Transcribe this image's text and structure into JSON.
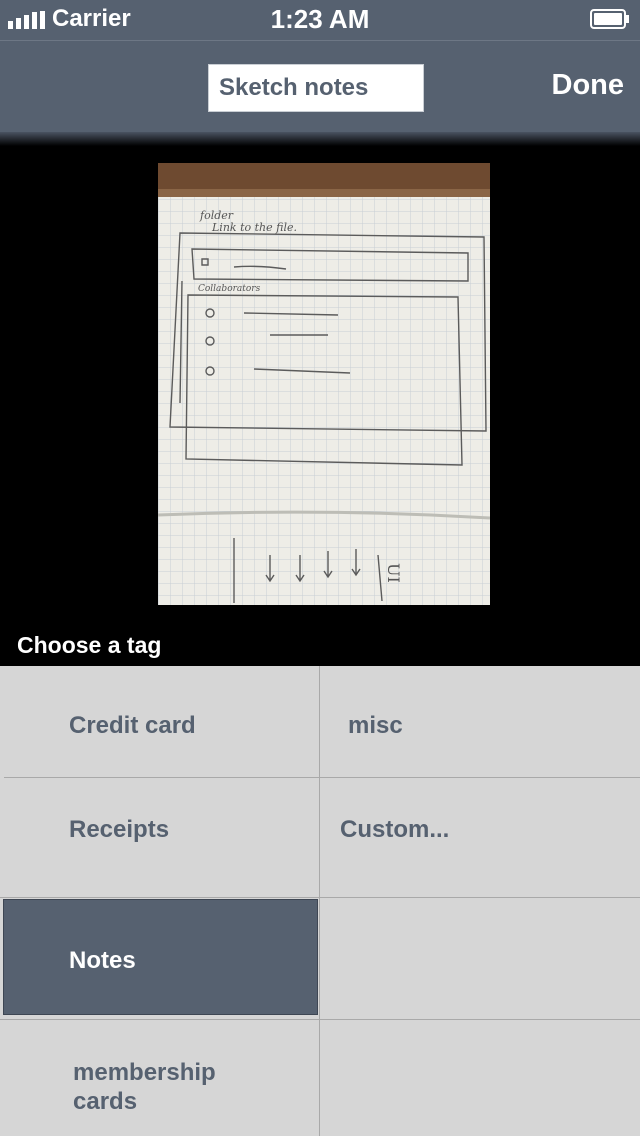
{
  "status_bar": {
    "carrier": "Carrier",
    "time": "1:23 AM"
  },
  "nav": {
    "title_value": "Sketch notes",
    "done_label": "Done"
  },
  "photo": {
    "handwriting_top": "folder",
    "handwriting_line": "Link to the file.",
    "handwriting_section": "Collaborators",
    "handwriting_bottom_ui": "UI"
  },
  "tags": {
    "header": "Choose a tag",
    "items": [
      {
        "label": "Credit card"
      },
      {
        "label": "misc"
      },
      {
        "label": "Receipts"
      },
      {
        "label": "Custom..."
      },
      {
        "label": "Notes",
        "selected": true
      },
      {
        "label": "membership cards"
      }
    ]
  },
  "colors": {
    "accent": "#566170",
    "cell_bg": "#d6d6d6",
    "divider": "#a9a9a9"
  }
}
